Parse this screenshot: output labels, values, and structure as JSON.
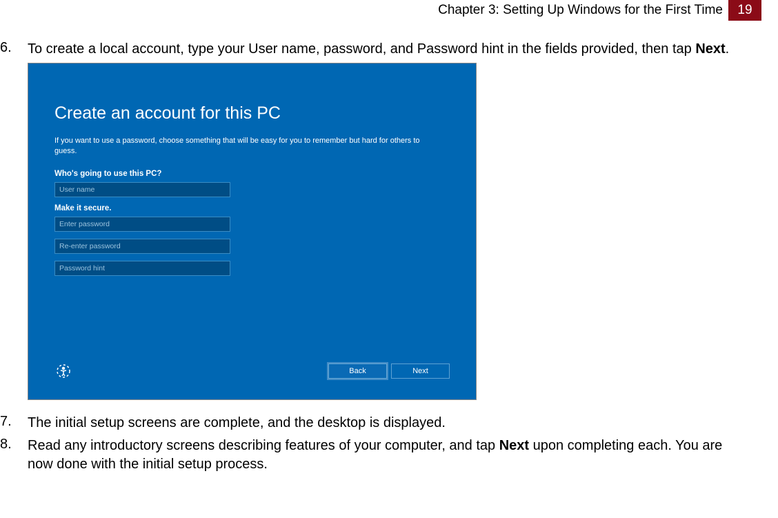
{
  "header": {
    "chapter": "Chapter 3: Setting Up Windows for the First Time",
    "page_number": "19"
  },
  "steps": {
    "s6": {
      "number": "6.",
      "text_a": "To create a local account, type your User name, password, and Password hint in the fields provided, then tap ",
      "bold": "Next",
      "text_b": "."
    },
    "s7": {
      "number": "7.",
      "text": "The initial setup screens are complete, and the desktop is displayed."
    },
    "s8": {
      "number": "8.",
      "text_a": "Read any introductory screens describing features of your computer, and tap ",
      "bold": "Next",
      "text_b": " upon completing each. You are now done with the initial setup process."
    }
  },
  "screenshot": {
    "title": "Create an account for this PC",
    "desc": "If you want to use a password, choose something that will be easy for you to remember but hard for others to guess.",
    "label_who": "Who's going to use this PC?",
    "input_user": "User name",
    "label_secure": "Make it secure.",
    "input_pass": "Enter password",
    "input_repass": "Re-enter password",
    "input_hint": "Password hint",
    "btn_back": "Back",
    "btn_next": "Next"
  }
}
